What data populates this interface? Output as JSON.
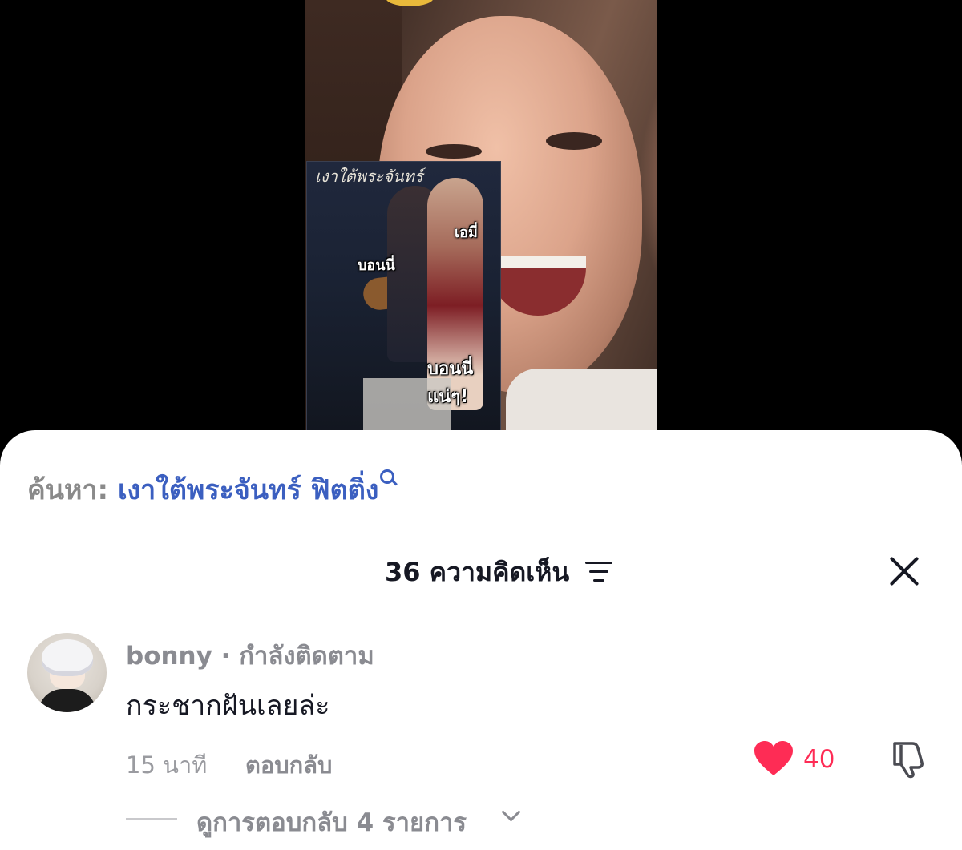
{
  "video": {
    "book_title": "เงาใต้พระจันทร์",
    "overlay_labels": [
      "เอมี่",
      "บอนนี่",
      "บอนนี่แน่ๆ!"
    ]
  },
  "search": {
    "prefix": "ค้นหา:",
    "query": "เงาใต้พระจันทร์ ฟิตติ่ง"
  },
  "comments_header": {
    "count_label": "36 ความคิดเห็น"
  },
  "comment": {
    "username": "bonny",
    "relation": "· กำลังติดตาม",
    "text": "กระชากฝันเลยล่ะ",
    "time": "15 นาที",
    "reply_label": "ตอบกลับ",
    "like_count": "40",
    "view_replies_label": "ดูการตอบกลับ 4 รายการ"
  },
  "colors": {
    "accent_link": "#3b5fc0",
    "like_red": "#fe2c55",
    "muted_text": "#8a8b91"
  }
}
